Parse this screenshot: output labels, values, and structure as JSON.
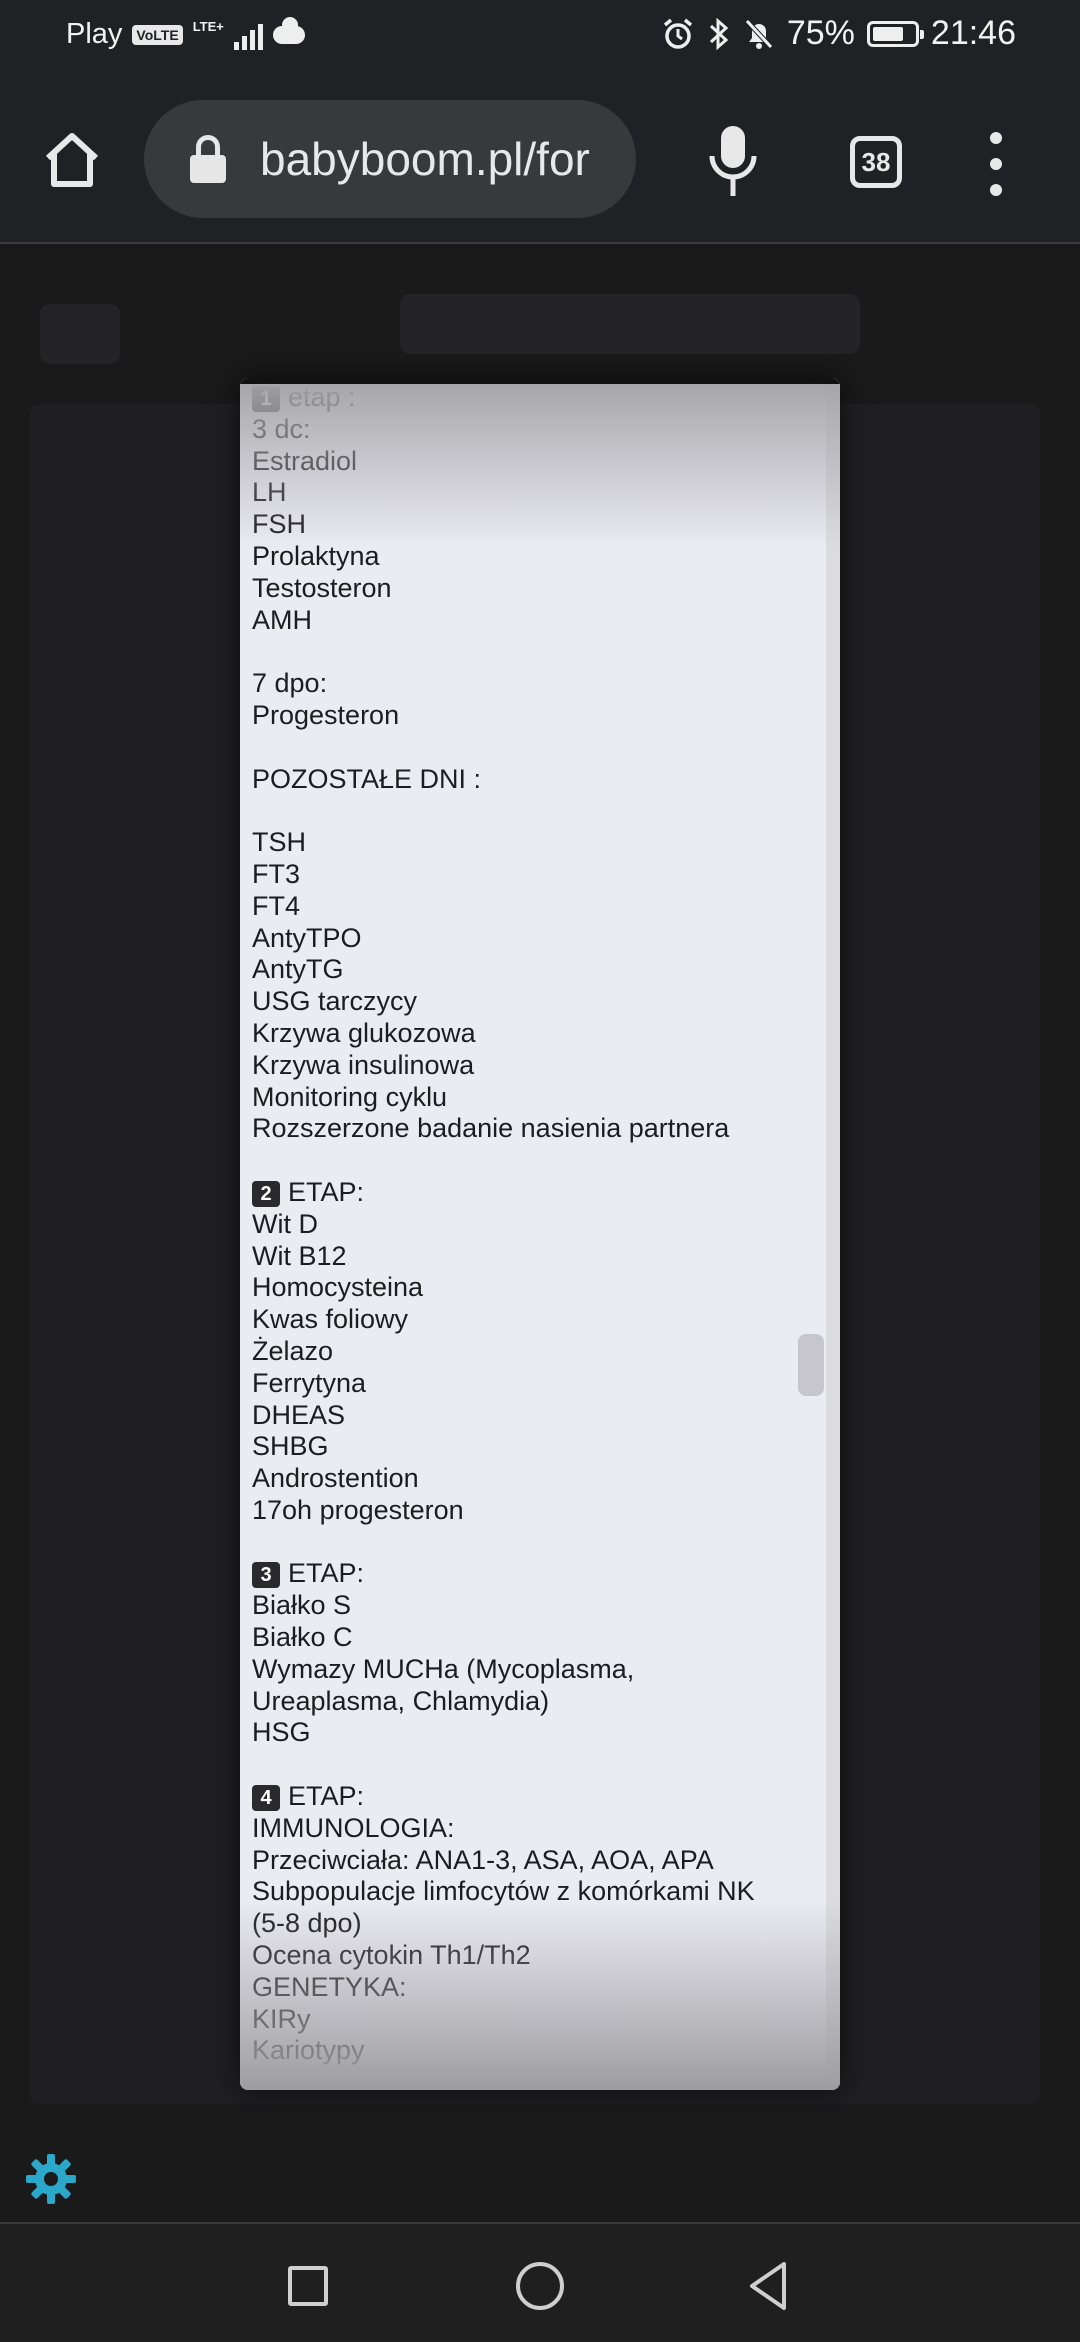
{
  "status_bar": {
    "carrier": "Play",
    "volte": "VoLTE",
    "network": "LTE+",
    "battery": "75%",
    "battery_level": 0.75,
    "time": "21:46"
  },
  "toolbar": {
    "url": "babyboom.pl/for",
    "tab_count": "38"
  },
  "note": {
    "lines": [
      {
        "badge": "1",
        "text": "etap :"
      },
      {
        "text": "3 dc:"
      },
      {
        "text": "Estradiol"
      },
      {
        "text": "LH"
      },
      {
        "text": "FSH"
      },
      {
        "text": "Prolaktyna"
      },
      {
        "text": "Testosteron"
      },
      {
        "text": "AMH"
      },
      {
        "text": ""
      },
      {
        "text": "7 dpo:"
      },
      {
        "text": "Progesteron"
      },
      {
        "text": ""
      },
      {
        "text": "POZOSTAŁE DNI :"
      },
      {
        "text": ""
      },
      {
        "text": "TSH"
      },
      {
        "text": "FT3"
      },
      {
        "text": "FT4"
      },
      {
        "text": "AntyTPO"
      },
      {
        "text": "AntyTG"
      },
      {
        "text": "USG tarczycy"
      },
      {
        "text": "Krzywa glukozowa"
      },
      {
        "text": "Krzywa insulinowa"
      },
      {
        "text": "Monitoring cyklu"
      },
      {
        "text": "Rozszerzone badanie nasienia partnera"
      },
      {
        "text": ""
      },
      {
        "badge": "2",
        "text": "ETAP:"
      },
      {
        "text": "Wit D"
      },
      {
        "text": "Wit B12"
      },
      {
        "text": "Homocysteina"
      },
      {
        "text": "Kwas foliowy"
      },
      {
        "text": "Żelazo"
      },
      {
        "text": "Ferrytyna"
      },
      {
        "text": "DHEAS"
      },
      {
        "text": "SHBG"
      },
      {
        "text": "Androstention"
      },
      {
        "text": "17oh progesteron"
      },
      {
        "text": ""
      },
      {
        "badge": "3",
        "text": "ETAP:"
      },
      {
        "text": "Białko S"
      },
      {
        "text": "Białko C"
      },
      {
        "text": "Wymazy MUCHa (Mycoplasma,"
      },
      {
        "text": "Ureaplasma, Chlamydia)"
      },
      {
        "text": "HSG"
      },
      {
        "text": ""
      },
      {
        "badge": "4",
        "text": "ETAP:"
      },
      {
        "text": "IMMUNOLOGIA:"
      },
      {
        "text": "Przeciwciała: ANA1-3, ASA, AOA, APA"
      },
      {
        "text": "Subpopulacje limfocytów z komórkami NK"
      },
      {
        "text": "(5-8 dpo)"
      },
      {
        "text": "Ocena cytokin Th1/Th2"
      },
      {
        "text": "GENETYKA:"
      },
      {
        "text": "KIRy"
      },
      {
        "text": "Kariotypy"
      }
    ]
  },
  "icons": {
    "home": "home-icon",
    "lock": "lock-icon",
    "mic": "microphone-icon",
    "menu": "more-vert-icon",
    "settings": "gear-icon",
    "accent_color": "#2aa7c9"
  }
}
